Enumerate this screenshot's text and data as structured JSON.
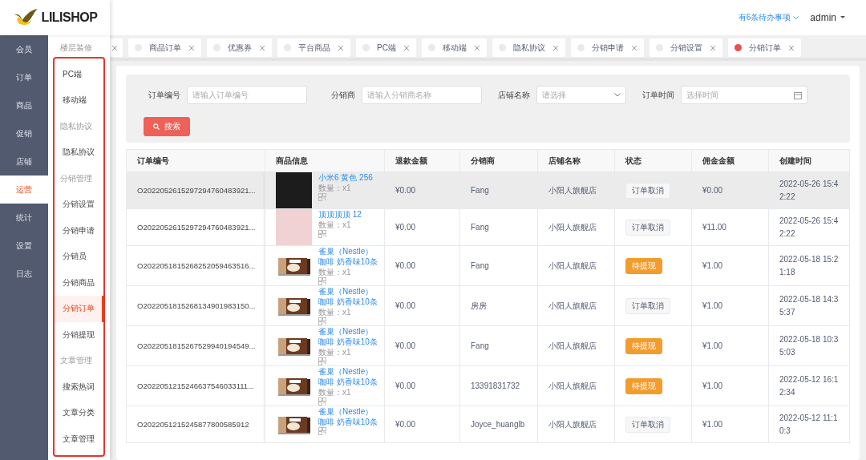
{
  "logo": {
    "text": "LILISHOP"
  },
  "header": {
    "todo": "有6条待办事项",
    "user": "admin"
  },
  "nav": [
    {
      "label": "会员",
      "selected": false
    },
    {
      "label": "订单",
      "selected": false
    },
    {
      "label": "商品",
      "selected": false
    },
    {
      "label": "促销",
      "selected": false
    },
    {
      "label": "店铺",
      "selected": false
    },
    {
      "label": "运营",
      "selected": true
    },
    {
      "label": "统计",
      "selected": false
    },
    {
      "label": "设置",
      "selected": false
    },
    {
      "label": "日志",
      "selected": false
    }
  ],
  "submenu": [
    {
      "kind": "group",
      "label": "楼层装修"
    },
    {
      "kind": "item",
      "label": "PC端",
      "selected": false
    },
    {
      "kind": "item",
      "label": "移动端",
      "selected": false
    },
    {
      "kind": "group",
      "label": "隐私协议"
    },
    {
      "kind": "item",
      "label": "隐私协议",
      "selected": false
    },
    {
      "kind": "group",
      "label": "分销管理"
    },
    {
      "kind": "item",
      "label": "分销设置",
      "selected": false
    },
    {
      "kind": "item",
      "label": "分销申请",
      "selected": false
    },
    {
      "kind": "item",
      "label": "分销员",
      "selected": false
    },
    {
      "kind": "item",
      "label": "分销商品",
      "selected": false
    },
    {
      "kind": "item",
      "label": "分销订单",
      "selected": true
    },
    {
      "kind": "item",
      "label": "分销提现",
      "selected": false
    },
    {
      "kind": "group",
      "label": "文章管理"
    },
    {
      "kind": "item",
      "label": "搜索热词",
      "selected": false
    },
    {
      "kind": "item",
      "label": "文章分类",
      "selected": false
    },
    {
      "kind": "item",
      "label": "文章管理",
      "selected": false
    }
  ],
  "tabs": [
    {
      "kind": "cut"
    },
    {
      "kind": "tab",
      "label": "商品订单",
      "selected": false
    },
    {
      "kind": "tab",
      "label": "优惠券",
      "selected": false
    },
    {
      "kind": "tab",
      "label": "平台商品",
      "selected": false
    },
    {
      "kind": "tab",
      "label": "PC端",
      "selected": false
    },
    {
      "kind": "tab",
      "label": "移动端",
      "selected": false
    },
    {
      "kind": "tab",
      "label": "隐私协议",
      "selected": false
    },
    {
      "kind": "tab",
      "label": "分销申请",
      "selected": false
    },
    {
      "kind": "tab",
      "label": "分销设置",
      "selected": false
    },
    {
      "kind": "tab",
      "label": "分销订单",
      "selected": true
    }
  ],
  "filters": [
    {
      "kind": "input",
      "label": "订单编号",
      "placeholder": "请输入订单编号"
    },
    {
      "kind": "input",
      "label": "分销商",
      "placeholder": "请输入分销商名称"
    },
    {
      "kind": "select",
      "label": "店铺名称",
      "placeholder": "请选择"
    },
    {
      "kind": "date",
      "label": "订单时间",
      "placeholder": "选择时间"
    }
  ],
  "search_button": "搜索",
  "table": {
    "columns": [
      "订单编号",
      "商品信息",
      "退款金额",
      "分销商",
      "店铺名称",
      "状态",
      "佣金金额",
      "创建时间"
    ],
    "rows": [
      {
        "selected": true,
        "order_no": "O2022052615297294760483921...",
        "thumb": {
          "kind": "dark"
        },
        "product": [
          "小米6 黄色 256"
        ],
        "qty": "数量：x1",
        "refund": "¥0.00",
        "distributor": "Fang",
        "shop": "小阳人旗舰店",
        "status": {
          "kind": "cancelled",
          "text": "订单取消"
        },
        "commission": "¥0.00",
        "created": "2022-05-26 15:42:22"
      },
      {
        "selected": false,
        "order_no": "O2022052615297294760483921...",
        "thumb": {
          "kind": "photo"
        },
        "product": [
          "顶顶顶顶 12"
        ],
        "qty": "数量：x1",
        "refund": "¥0.00",
        "distributor": "Fang",
        "shop": "小阳人旗舰店",
        "status": {
          "kind": "cancelled",
          "text": "订单取消"
        },
        "commission": "¥11.00",
        "created": "2022-05-26 15:42:22"
      },
      {
        "selected": false,
        "order_no": "O2022051815268252059463516...",
        "thumb": {
          "kind": "coffee"
        },
        "product": [
          "雀巢（Nestle）",
          "咖啡 奶香味10条"
        ],
        "qty": "数量：x1",
        "refund": "¥0.00",
        "distributor": "Fang",
        "shop": "小阳人旗舰店",
        "status": {
          "kind": "pending",
          "text": "待提现"
        },
        "commission": "¥1.00",
        "created": "2022-05-18 15:21:18"
      },
      {
        "selected": false,
        "order_no": "O2022051815268134901983150...",
        "thumb": {
          "kind": "coffee"
        },
        "product": [
          "雀巢（Nestle）",
          "咖啡 奶香味10条"
        ],
        "qty": "数量：x1",
        "refund": "¥0.00",
        "distributor": "房房",
        "shop": "小阳人旗舰店",
        "status": {
          "kind": "cancelled",
          "text": "订单取消"
        },
        "commission": "¥1.00",
        "created": "2022-05-18 14:35:37"
      },
      {
        "selected": false,
        "order_no": "O2022051815267529940194549...",
        "thumb": {
          "kind": "coffee"
        },
        "product": [
          "雀巢（Nestle）",
          "咖啡 奶香味10条"
        ],
        "qty": "数量：x1",
        "refund": "¥0.00",
        "distributor": "Fang",
        "shop": "小阳人旗舰店",
        "status": {
          "kind": "pending",
          "text": "待提现"
        },
        "commission": "¥1.00",
        "created": "2022-05-18 10:35:03"
      },
      {
        "selected": false,
        "order_no": "O2022051215246637546033111...",
        "thumb": {
          "kind": "coffee"
        },
        "product": [
          "雀巢（Nestle）",
          "咖啡 奶香味10条"
        ],
        "qty": "数量：x1",
        "refund": "¥0.00",
        "distributor": "13391831732",
        "shop": "小阳人旗舰店",
        "status": {
          "kind": "pending",
          "text": "待提现"
        },
        "commission": "¥1.00",
        "created": "2022-05-12 16:12:34"
      },
      {
        "selected": false,
        "order_no": "O2022051215245877800585912",
        "thumb": {
          "kind": "coffee"
        },
        "product": [
          "雀巢（Nestle）",
          "咖啡 奶香味10条"
        ],
        "refund": "¥0.00",
        "distributor": "Joyce_huanglb",
        "shop": "小阳人旗舰店",
        "status": {
          "kind": "cancelled",
          "text": "订单取消"
        },
        "commission": "¥1.00",
        "created": "2022-05-12 11:10:3"
      }
    ]
  }
}
